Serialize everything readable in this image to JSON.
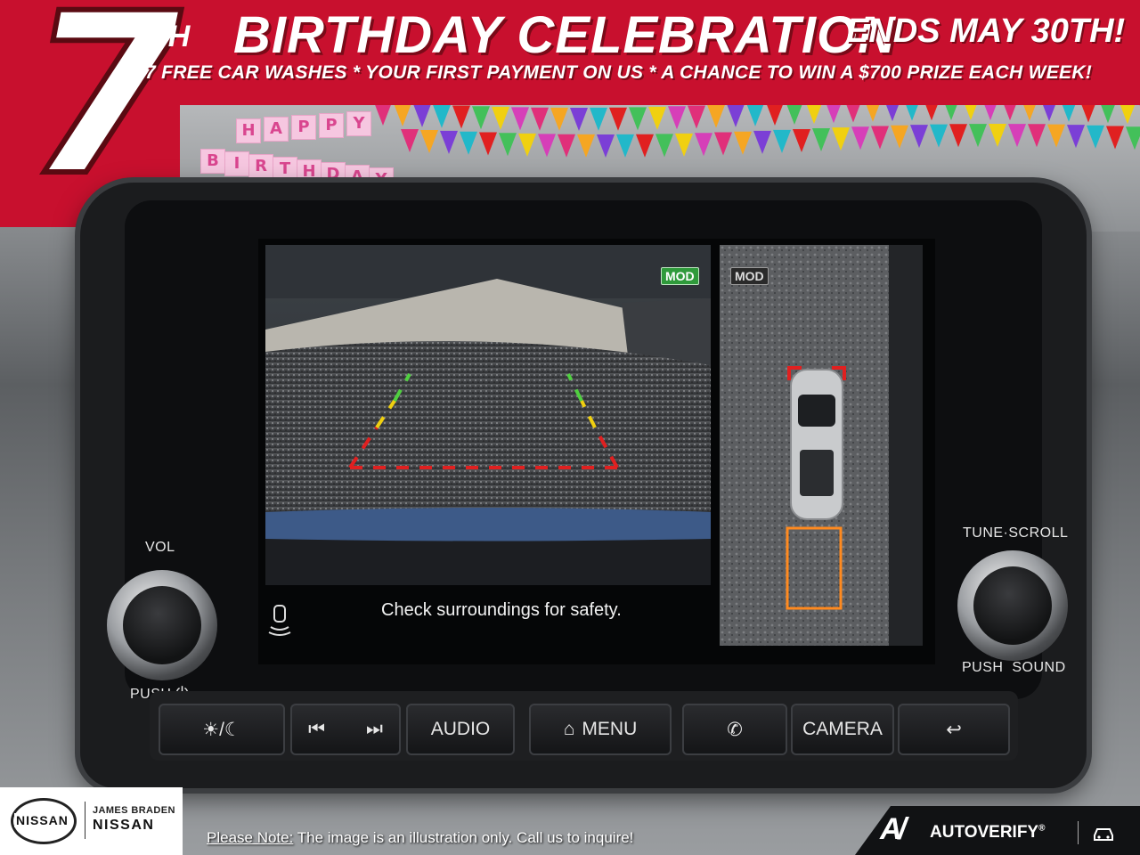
{
  "banner": {
    "number": "7",
    "suffix": "TH",
    "title": "BIRTHDAY CELEBRATION",
    "ends": "ENDS MAY 30TH!",
    "subtitle": "7 FREE CAR WASHES * YOUR FIRST PAYMENT ON US * A CHANCE TO WIN A $700 PRIZE EACH WEEK!",
    "accent_color": "#c8102e"
  },
  "bunting": {
    "happy": [
      "H",
      "A",
      "P",
      "P",
      "Y"
    ],
    "birthday": [
      "B",
      "I",
      "R",
      "T",
      "H",
      "D",
      "A",
      "Y"
    ]
  },
  "screen": {
    "mod_rear": "MOD",
    "mod_top": "MOD",
    "safety_message": "Check surroundings for safety.",
    "sensor_icon": "parking-sensor-icon"
  },
  "knobs": {
    "left_top": "VOL",
    "left_bottom": "PUSH",
    "left_bottom_icon": "power-icon",
    "right_top": "TUNE·SCROLL",
    "right_bottom": "PUSH  SOUND"
  },
  "buttons": {
    "brightness_icon": "day-night-icon",
    "prev_icon": "skip-back-icon",
    "next_icon": "skip-forward-icon",
    "audio": "AUDIO",
    "menu": "MENU",
    "menu_icon": "home-icon",
    "phone_icon": "phone-icon",
    "camera": "CAMERA",
    "back_icon": "back-arrow-icon"
  },
  "footer": {
    "brand": "NISSAN",
    "dealer_line1": "JAMES BRADEN",
    "dealer_line2": "NISSAN",
    "note_label": "Please Note:",
    "note_text": " The image is an illustration only. Call us to inquire!",
    "autoverify": "AUTOVERIFY",
    "registered": "®"
  }
}
